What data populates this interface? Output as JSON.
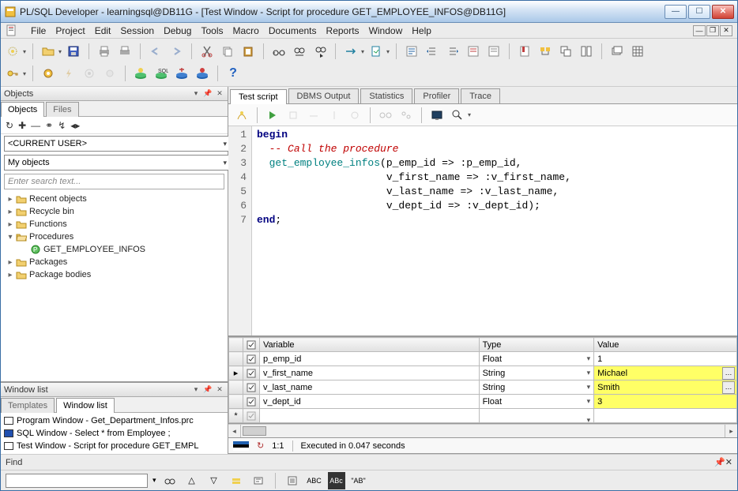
{
  "title": "PL/SQL Developer - learningsql@DB11G - [Test Window - Script for procedure GET_EMPLOYEE_INFOS@DB11G]",
  "menu": [
    "File",
    "Project",
    "Edit",
    "Session",
    "Debug",
    "Tools",
    "Macro",
    "Documents",
    "Reports",
    "Window",
    "Help"
  ],
  "objects_panel": {
    "title": "Objects",
    "tabs": [
      "Objects",
      "Files"
    ],
    "current_user": "<CURRENT USER>",
    "my_objects": "My objects",
    "search_placeholder": "Enter search text...",
    "tree": [
      {
        "label": "Recent objects",
        "expanded": false,
        "level": 0,
        "icon": "folder"
      },
      {
        "label": "Recycle bin",
        "expanded": false,
        "level": 0,
        "icon": "folder"
      },
      {
        "label": "Functions",
        "expanded": false,
        "level": 0,
        "icon": "folder"
      },
      {
        "label": "Procedures",
        "expanded": true,
        "level": 0,
        "icon": "folder-open"
      },
      {
        "label": "GET_EMPLOYEE_INFOS",
        "expanded": null,
        "level": 1,
        "icon": "proc"
      },
      {
        "label": "Packages",
        "expanded": false,
        "level": 0,
        "icon": "folder"
      },
      {
        "label": "Package bodies",
        "expanded": false,
        "level": 0,
        "icon": "folder"
      }
    ]
  },
  "window_list": {
    "title": "Window list",
    "tabs": [
      "Templates",
      "Window list"
    ],
    "items": [
      {
        "label": "Program Window - Get_Department_Infos.prc",
        "color": "#fff"
      },
      {
        "label": "SQL Window - Select * from Employee ;",
        "color": "#2050b0"
      },
      {
        "label": "Test Window - Script for procedure GET_EMPL",
        "color": "#fff"
      }
    ]
  },
  "editor": {
    "tabs": [
      "Test script",
      "DBMS Output",
      "Statistics",
      "Profiler",
      "Trace"
    ],
    "active_tab": 0,
    "lines": [
      "1",
      "2",
      "3",
      "4",
      "5",
      "6",
      "7"
    ],
    "code_html": "<span class='kw'>begin</span>\n  <span class='cm'>-- Call the procedure</span>\n  <span class='id'>get_employee_infos</span>(p_emp_id <span class='op'>=&gt;</span> :p_emp_id,\n                     v_first_name <span class='op'>=&gt;</span> :v_first_name,\n                     v_last_name <span class='op'>=&gt;</span> :v_last_name,\n                     v_dept_id <span class='op'>=&gt;</span> :v_dept_id);\n<span class='kw'>end</span>;"
  },
  "vars": {
    "cols": [
      "Variable",
      "Type",
      "Value"
    ],
    "rows": [
      {
        "chk": true,
        "var": "p_emp_id",
        "type": "Float",
        "val": "1",
        "hl": false,
        "btn": false,
        "marker": ""
      },
      {
        "chk": true,
        "var": "v_first_name",
        "type": "String",
        "val": "Michael",
        "hl": true,
        "btn": true,
        "marker": "▸"
      },
      {
        "chk": true,
        "var": "v_last_name",
        "type": "String",
        "val": "Smith",
        "hl": true,
        "btn": true,
        "marker": ""
      },
      {
        "chk": true,
        "var": "v_dept_id",
        "type": "Float",
        "val": "3",
        "hl": true,
        "btn": false,
        "marker": ""
      }
    ]
  },
  "status": {
    "pos": "1:1",
    "msg": "Executed in 0.047 seconds"
  },
  "find": {
    "label": "Find",
    "ab_caps": "ABC",
    "ab_inv": "ABc",
    "ab_q": "\"AB\""
  }
}
